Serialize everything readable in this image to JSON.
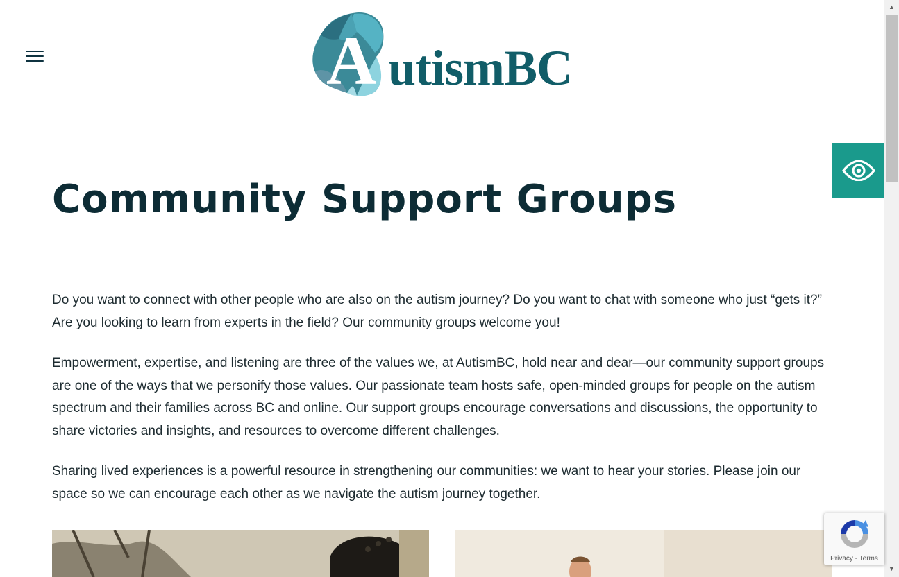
{
  "header": {
    "logo_letter": "A",
    "logo_text": "utismBC"
  },
  "main": {
    "title": "Community Support Groups",
    "paragraphs": [
      "Do you want to connect with other people who are also on the autism journey? Do you want to chat with someone who just “gets it?” Are you looking to learn from experts in the field? Our community groups welcome you!",
      "Empowerment, expertise, and listening are three of the values we, at AutismBC, hold near and dear—our community support groups are one of the ways that we personify those values. Our passionate team hosts safe, open-minded groups for people on the autism spectrum and their families across BC and online. Our support groups encourage conversations and discussions, the opportunity to share victories and insights, and resources to overcome different challenges.",
      "Sharing lived experiences is a powerful resource in strengthening our communities: we want to hear your stories. Please join our space so we can encourage each other as we navigate the autism journey together."
    ]
  },
  "accessibility": {
    "icon": "eye-icon",
    "color": "#1a9a8c"
  },
  "recaptcha": {
    "privacy": "Privacy",
    "separator": " - ",
    "terms": "Terms"
  },
  "colors": {
    "brand_teal": "#115d68",
    "title": "#0d2c35"
  }
}
